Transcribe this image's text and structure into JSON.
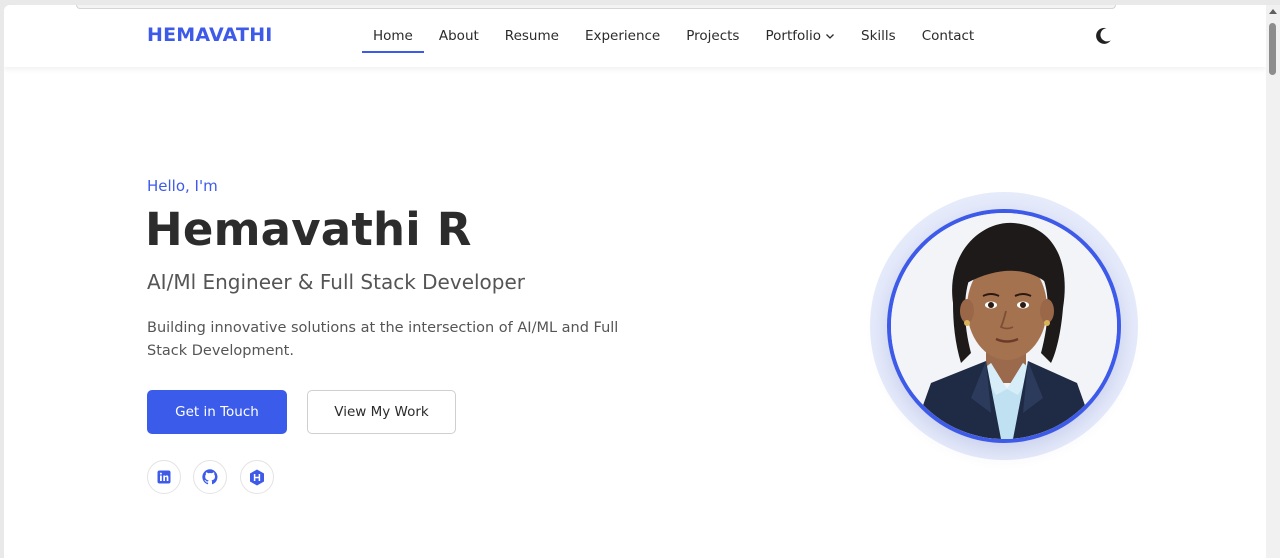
{
  "colors": {
    "accent": "#3d5be8",
    "primary_button": "#3b5bea",
    "text_dark": "#2c2c2c",
    "text_muted": "#555555"
  },
  "brand": "HEMAVATHI",
  "nav": {
    "items": [
      {
        "label": "Home",
        "active": true
      },
      {
        "label": "About"
      },
      {
        "label": "Resume"
      },
      {
        "label": "Experience"
      },
      {
        "label": "Projects"
      },
      {
        "label": "Portfolio",
        "dropdown": true
      },
      {
        "label": "Skills"
      },
      {
        "label": "Contact"
      }
    ],
    "theme_toggle_icon": "moon-icon"
  },
  "hero": {
    "greeting": "Hello, I'm",
    "name": "Hemavathi R",
    "role": "AI/Ml Engineer & Full Stack Developer",
    "description": "Building innovative solutions at the intersection of AI/ML and Full Stack Development.",
    "primary_button": "Get in Touch",
    "secondary_button": "View My Work",
    "social": [
      {
        "icon": "linkedin-icon"
      },
      {
        "icon": "github-icon"
      },
      {
        "icon": "hackerrank-icon"
      }
    ],
    "avatar_icon": "profile-photo"
  }
}
